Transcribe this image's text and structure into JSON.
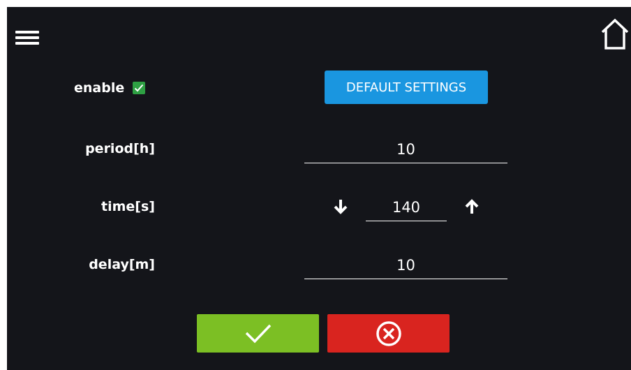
{
  "header": {
    "menu_icon": "hamburger-menu-icon",
    "home_icon": "home-icon"
  },
  "enable": {
    "label": "enable",
    "checked": true,
    "check_color": "#2ea043"
  },
  "default_settings": {
    "label": "DEFAULT SETTINGS",
    "color": "#1a96e0"
  },
  "fields": {
    "period": {
      "label": "period[h]",
      "value": "10"
    },
    "time": {
      "label": "time[s]",
      "value": "140"
    },
    "delay": {
      "label": "delay[m]",
      "value": "10"
    }
  },
  "actions": {
    "confirm_icon": "checkmark-icon",
    "confirm_color": "#7cbf24",
    "cancel_icon": "circle-x-icon",
    "cancel_color": "#d9241f"
  }
}
